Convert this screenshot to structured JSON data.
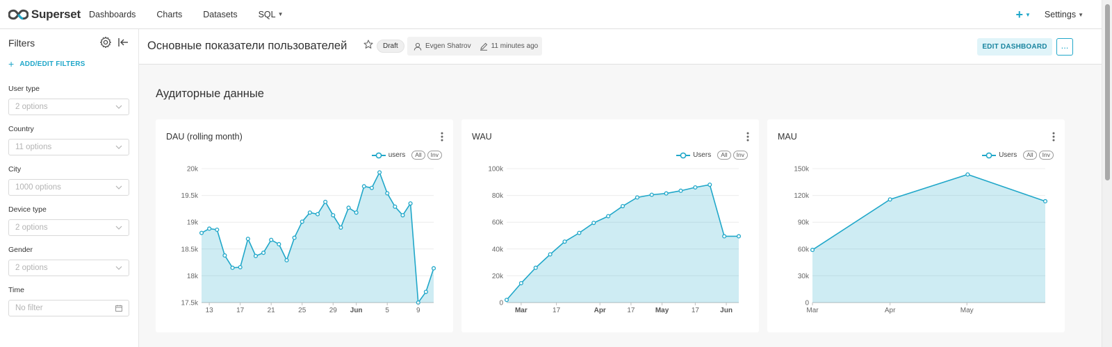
{
  "nav": {
    "brand": "Superset",
    "links": [
      "Dashboards",
      "Charts",
      "Datasets",
      "SQL"
    ],
    "plus": "+",
    "settings": "Settings",
    "accent": "#20a7c9"
  },
  "sidebar": {
    "title": "Filters",
    "add_label": "ADD/EDIT FILTERS",
    "filters": [
      {
        "label": "User type",
        "placeholder": "2 options"
      },
      {
        "label": "Country",
        "placeholder": "11 options"
      },
      {
        "label": "City",
        "placeholder": "1000 options"
      },
      {
        "label": "Device type",
        "placeholder": "2 options"
      },
      {
        "label": "Gender",
        "placeholder": "2 options"
      },
      {
        "label": "Time",
        "placeholder": "No filter"
      }
    ]
  },
  "header": {
    "title": "Основные показатели пользователей",
    "status": "Draft",
    "owner": "Evgen Shatrov",
    "modified": "11 minutes ago",
    "edit_label": "EDIT DASHBOARD",
    "more_label": "..."
  },
  "section": {
    "title": "Аудиторные данные"
  },
  "chart_data": [
    {
      "type": "area",
      "title": "DAU (rolling month)",
      "legend": {
        "name": "users",
        "pills": [
          "All",
          "Inv"
        ]
      },
      "color": "#20a7c9",
      "x_ticks": [
        {
          "label": "13",
          "i": 1,
          "bold": false
        },
        {
          "label": "17",
          "i": 5,
          "bold": false
        },
        {
          "label": "21",
          "i": 9,
          "bold": false
        },
        {
          "label": "25",
          "i": 13,
          "bold": false
        },
        {
          "label": "29",
          "i": 17,
          "bold": false
        },
        {
          "label": "Jun",
          "i": 20,
          "bold": true
        },
        {
          "label": "5",
          "i": 24,
          "bold": false
        },
        {
          "label": "9",
          "i": 28,
          "bold": false
        }
      ],
      "y_ticks": [
        17500,
        18000,
        18500,
        19000,
        19500,
        20000
      ],
      "y_tick_labels": [
        "17.5k",
        "18k",
        "18.5k",
        "19k",
        "19.5k",
        "20k"
      ],
      "ylim": [
        17500,
        20000
      ],
      "n_x": 31,
      "values": [
        18800,
        18880,
        18860,
        18380,
        18150,
        18160,
        18690,
        18370,
        18430,
        18670,
        18590,
        18290,
        18710,
        19010,
        19180,
        19150,
        19380,
        19130,
        18900,
        19270,
        19180,
        19670,
        19640,
        19930,
        19540,
        19290,
        19130,
        19350,
        17500,
        17700,
        18140
      ]
    },
    {
      "type": "area",
      "title": "WAU",
      "legend": {
        "name": "Users",
        "pills": [
          "All",
          "Inv"
        ]
      },
      "color": "#20a7c9",
      "x_ticks": [
        {
          "label": "Mar",
          "i": 1,
          "bold": true
        },
        {
          "label": "17",
          "i": 3.43,
          "bold": false
        },
        {
          "label": "Apr",
          "i": 6.43,
          "bold": true
        },
        {
          "label": "17",
          "i": 8.57,
          "bold": false
        },
        {
          "label": "May",
          "i": 10.71,
          "bold": true
        },
        {
          "label": "17",
          "i": 13,
          "bold": false
        },
        {
          "label": "Jun",
          "i": 15.14,
          "bold": true
        }
      ],
      "y_ticks": [
        0,
        20000,
        40000,
        60000,
        80000,
        100000
      ],
      "y_tick_labels": [
        "0",
        "20k",
        "40k",
        "60k",
        "80k",
        "100k"
      ],
      "ylim": [
        0,
        100000
      ],
      "n_x": 17,
      "values": [
        2000,
        14500,
        26000,
        36000,
        45500,
        52000,
        59500,
        64500,
        72000,
        78500,
        80500,
        81500,
        83500,
        86000,
        88000,
        49500,
        49500
      ]
    },
    {
      "type": "area",
      "title": "MAU",
      "legend": {
        "name": "Users",
        "pills": [
          "All",
          "Inv"
        ]
      },
      "color": "#20a7c9",
      "x_ticks": [
        {
          "label": "Mar",
          "i": 0,
          "bold": false
        },
        {
          "label": "Apr",
          "i": 1,
          "bold": false
        },
        {
          "label": "May",
          "i": 1.99,
          "bold": false
        }
      ],
      "y_ticks": [
        0,
        30000,
        60000,
        90000,
        120000,
        150000
      ],
      "y_tick_labels": [
        "0",
        "30k",
        "60k",
        "90k",
        "120k",
        "150k"
      ],
      "ylim": [
        0,
        150000
      ],
      "n_x": 4,
      "values": [
        59000,
        115500,
        143500,
        113500
      ]
    }
  ]
}
